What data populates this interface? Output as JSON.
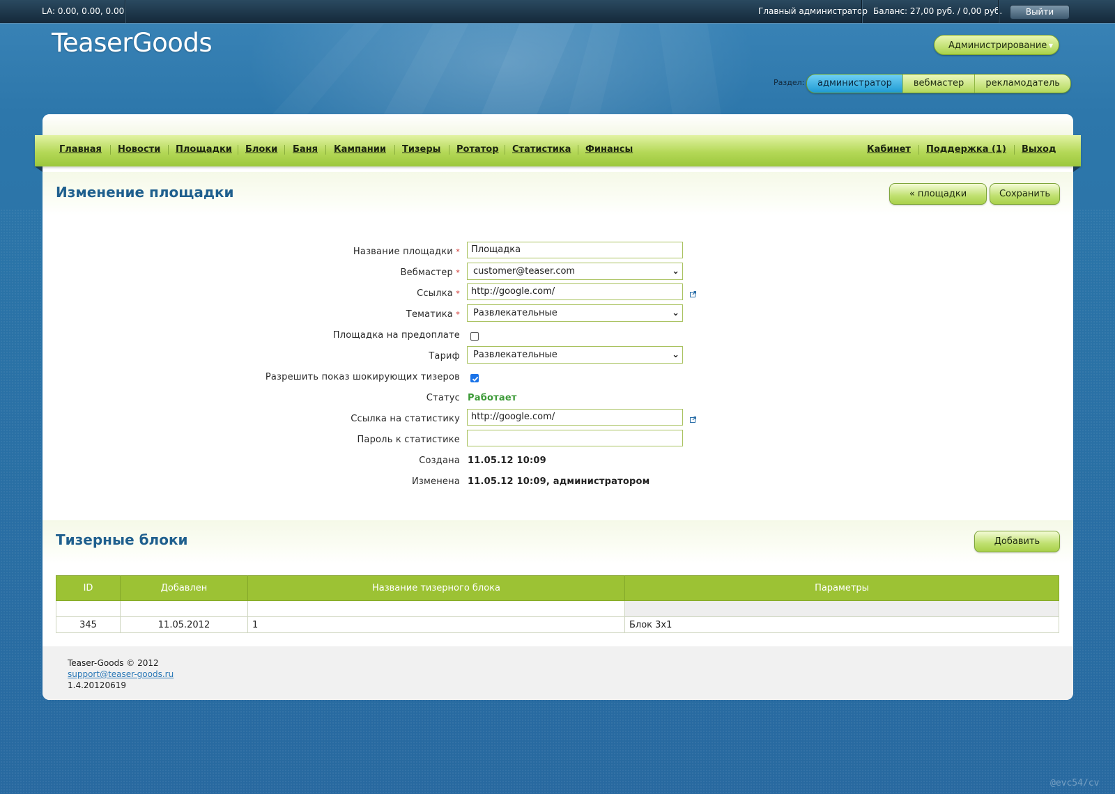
{
  "topbar": {
    "la": "LA: 0.00, 0.00, 0.00",
    "admin_name": "Главный администратор",
    "balance": "Баланс: 27,00 руб. / 0,00 руб.",
    "logout": "Выйти"
  },
  "logo": "TeaserGoods",
  "admin_menu": "Администрирование",
  "roles": {
    "label": "Раздел:",
    "items": [
      "администратор",
      "вебмастер",
      "рекламодатель"
    ],
    "active": "администратор"
  },
  "nav": {
    "left": [
      "Главная",
      "Новости",
      "Площадки",
      "Блоки",
      "Баня",
      "Кампании",
      "Тизеры",
      "Ротатор",
      "Статистика",
      "Финансы"
    ],
    "right": [
      "Кабинет",
      "Поддержка (1)",
      "Выход"
    ]
  },
  "edit_section": {
    "title": "Изменение площадки",
    "back_button": "« площадки",
    "save_button": "Сохранить"
  },
  "form": {
    "name_label": "Название площадки",
    "name_value": "Площадка",
    "webmaster_label": "Вебмастер",
    "webmaster_value": "customer@teaser.com",
    "link_label": "Ссылка",
    "link_value": "http://google.com/",
    "theme_label": "Тематика",
    "theme_value": "Развлекательные",
    "prepaid_label": "Площадка на предоплате",
    "prepaid_checked": false,
    "tariff_label": "Тариф",
    "tariff_value": "Развлекательные",
    "shocking_label": "Разрешить показ шокирующих тизеров",
    "shocking_checked": true,
    "status_label": "Статус",
    "status_value": "Работает",
    "stats_link_label": "Ссылка на статистику",
    "stats_link_value": "http://google.com/",
    "stats_password_label": "Пароль к статистике",
    "stats_password_value": "",
    "created_label": "Создана",
    "created_value": "11.05.12 10:09",
    "modified_label": "Изменена",
    "modified_value": "11.05.12 10:09, администратором",
    "required_mark": "*"
  },
  "blocks_section": {
    "title": "Тизерные блоки",
    "add_button": "Добавить"
  },
  "table": {
    "headers": [
      "ID",
      "Добавлен",
      "Название тизерного блока",
      "Параметры"
    ],
    "rows": [
      [
        "345",
        "11.05.2012",
        "1",
        "Блок 3x1"
      ]
    ]
  },
  "footer": {
    "copyright": "Teaser-Goods © 2012",
    "email": "support@teaser-goods.ru",
    "version": "1.4.20120619"
  },
  "watermark": "@evc54/cv",
  "colors": {
    "accent_green": "#9cc234",
    "title_blue": "#1f5f8e",
    "status_green": "#3c9a37",
    "background_blue": "#2c73a6"
  }
}
